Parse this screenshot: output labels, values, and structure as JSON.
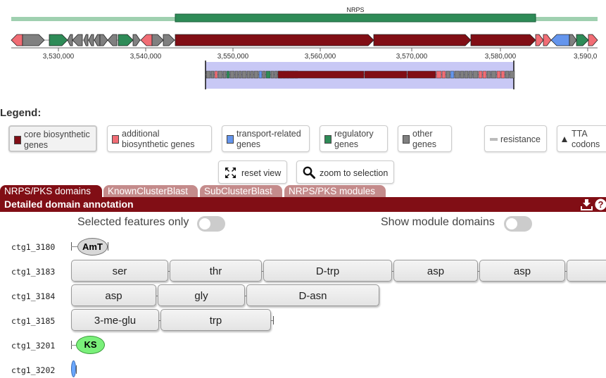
{
  "cluster": {
    "region_label": "NRPS",
    "axis_labels": [
      "3,530,000",
      "3,540,000",
      "3,550,000",
      "3,560,000",
      "3,570,000",
      "3,580,000",
      "3,590,0"
    ]
  },
  "legend": {
    "title": "Legend:",
    "items": [
      {
        "label1": "core biosynthetic",
        "label2": "genes",
        "color": "#810e15"
      },
      {
        "label1": "additional",
        "label2": "biosynthetic genes",
        "color": "#f16d75"
      },
      {
        "label1": "transport-related",
        "label2": "genes",
        "color": "#6495ed"
      },
      {
        "label1": "regulatory",
        "label2": "genes",
        "color": "#2e8b57"
      },
      {
        "label1": "other",
        "label2": "genes",
        "color": "#808080"
      },
      {
        "label1": "resistance",
        "label2": "",
        "color": "#bbbbbb"
      },
      {
        "label1": "TTA",
        "label2": "codons",
        "color": "#333333"
      }
    ]
  },
  "tools": {
    "reset_label": "reset view",
    "zoom_label": "zoom to selection"
  },
  "tabs": [
    "NRPS/PKS domains",
    "KnownClusterBlast",
    "SubClusterBlast",
    "NRPS/PKS modules"
  ],
  "panel": {
    "title": "Detailed domain annotation",
    "selected_only": "Selected features only",
    "show_modules": "Show module domains"
  },
  "rows": [
    {
      "id": "ctg1_3180",
      "domains": [
        "AmT"
      ]
    },
    {
      "id": "ctg1_3183",
      "domains": [
        "ser",
        "thr",
        "D-trp",
        "asp",
        "asp"
      ]
    },
    {
      "id": "ctg1_3184",
      "domains": [
        "asp",
        "gly",
        "D-asn"
      ]
    },
    {
      "id": "ctg1_3185",
      "domains": [
        "3-me-glu",
        "trp"
      ]
    },
    {
      "id": "ctg1_3201",
      "domains": [
        "KS"
      ]
    },
    {
      "id": "ctg1_3202",
      "domains": []
    }
  ]
}
